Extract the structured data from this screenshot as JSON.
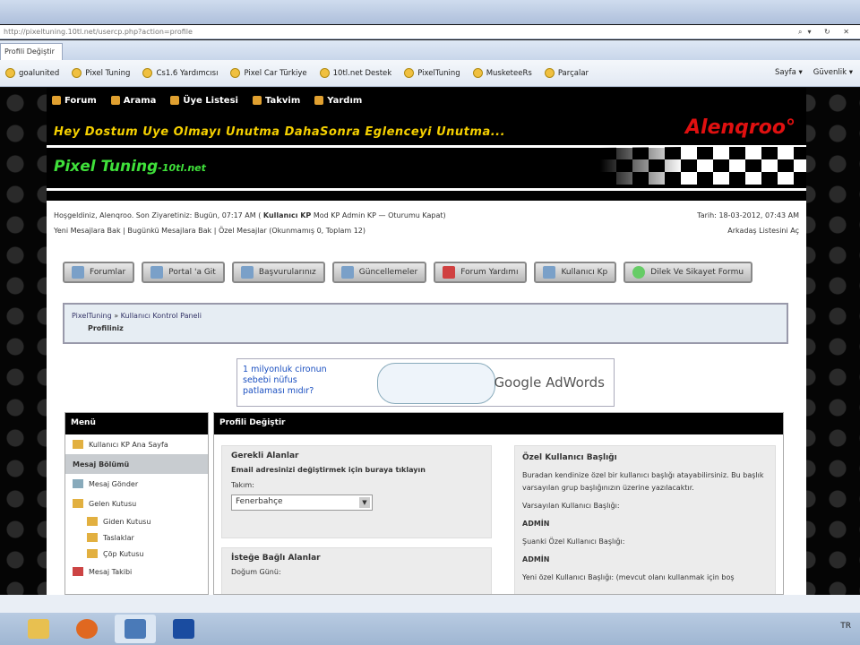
{
  "browser": {
    "url": "http://pixeltuning.10tl.net/usercp.php?action=profile",
    "tab_title": "Profili Değiştir",
    "favorites": [
      "goalunited",
      "Pixel Tuning",
      "Cs1.6 Yardımcısı",
      "Pixel Car Türkiye",
      "10tl.net Destek",
      "PixelTuning",
      "MusketeeRs",
      "Parçalar"
    ],
    "tools": [
      "Sayfa ▾",
      "Güvenlik ▾"
    ]
  },
  "forum_nav": {
    "items": [
      "Forum",
      "Arama",
      "Üye Listesi",
      "Takvim",
      "Yardım"
    ]
  },
  "banner": {
    "slogan": "Hey Dostum Uye Olmayı Unutma DahaSonra Eglenceyi Unutma...",
    "brand": "Alenqroo°",
    "site": "Pixel Tuning",
    "site_suffix": "-10tl.net"
  },
  "welcome": {
    "line1": "Hoşgeldiniz, Alenqroo. Son Ziyaretiniz: Bugün, 07:17 AM (",
    "links1": [
      "Kullanıcı KP",
      "Mod KP",
      "Admin KP —",
      "Oturumu Kapat)"
    ],
    "line2": [
      "Yeni Mesajlara Bak |",
      "Bugünkü Mesajlara Bak |",
      "Özel Mesajlar (Okunmamış 0, Toplam 12)"
    ],
    "date": "Tarih: 18-03-2012, 07:43 AM",
    "friends": "Arkadaş Listesini Aç"
  },
  "buttons": [
    "Forumlar",
    "Portal 'a Git",
    "Başvurularınız",
    "Güncellemeler",
    "Forum Yardımı",
    "Kullanıcı Kp",
    "Dilek Ve Sikayet Formu"
  ],
  "breadcrumb": {
    "root": "PixelTuning",
    "sep": " » ",
    "panel": "Kullanıcı Kontrol Paneli",
    "current": "Profiliniz"
  },
  "ad": {
    "line1": "1 milyonluk cironun",
    "line2": "sebebi nüfus",
    "line3": "patlaması mıdır?",
    "brand": "Google AdWords"
  },
  "menu": {
    "title": "Menü",
    "home": "Kullanıcı KP Ana Sayfa",
    "section": "Mesaj Bölümü",
    "send": "Mesaj Gönder",
    "inbox": "Gelen Kutusu",
    "sent": "Giden Kutusu",
    "drafts": "Taslaklar",
    "trash": "Çöp Kutusu",
    "tracking": "Mesaj Takibi"
  },
  "profile": {
    "title": "Profili Değiştir",
    "required_title": "Gerekli Alanlar",
    "email_note": "Email adresinizi değiştirmek için buraya tıklayın",
    "team_label": "Takım:",
    "team_value": "Fenerbahçe",
    "optional_title": "İsteğe Bağlı Alanlar",
    "birthday_label": "Doğum Günü:",
    "custom_title_head": "Özel Kullanıcı Başlığı",
    "custom_desc": "Buradan kendinize özel bir kullanıcı başlığı atayabilirsiniz. Bu başlık varsayılan grup başlığınızın üzerine yazılacaktır.",
    "default_title_label": "Varsayılan Kullanıcı Başlığı:",
    "default_title_value": "ADMİN",
    "current_title_label": "Şuanki Özel Kullanıcı Başlığı:",
    "current_title_value": "ADMİN",
    "new_title_label": "Yeni özel Kullanıcı Başlığı: (mevcut olanı kullanmak için boş"
  },
  "tray": {
    "lang": "TR"
  }
}
